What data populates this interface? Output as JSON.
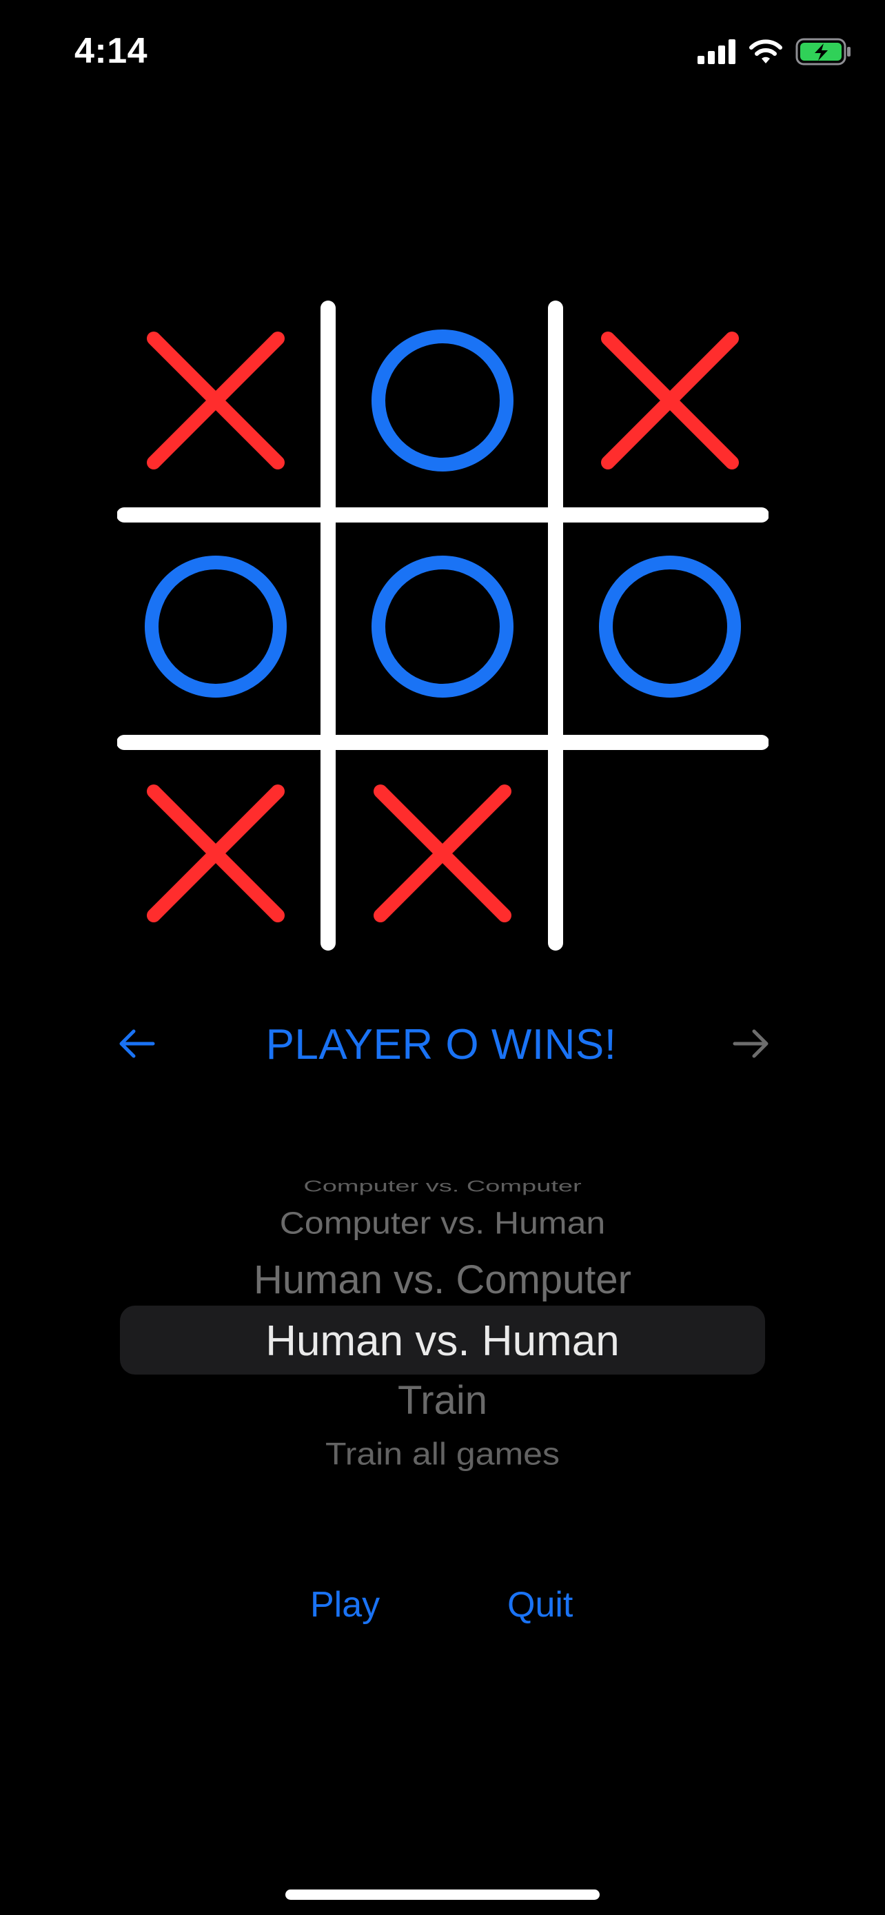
{
  "status_bar": {
    "time": "4:14",
    "icons": [
      "cellular-signal-icon",
      "wifi-icon",
      "battery-charging-icon"
    ]
  },
  "board": {
    "cells": [
      "X",
      "O",
      "X",
      "O",
      "O",
      "O",
      "X",
      "X",
      ""
    ],
    "x_color": "#ff2d2d",
    "o_color": "#1a73f5",
    "grid_color": "#ffffff"
  },
  "result": {
    "text": "PLAYER O WINS!",
    "left_arrow_icon": "arrow-left-icon",
    "right_arrow_icon": "arrow-right-icon"
  },
  "mode_picker": {
    "options": [
      "Computer vs. Computer",
      "Computer vs. Human",
      "Human vs. Computer",
      "Human vs. Human",
      "Train",
      "Train all games"
    ],
    "selected": "Human vs. Human"
  },
  "actions": {
    "play_label": "Play",
    "quit_label": "Quit"
  },
  "colors": {
    "background": "#000000",
    "accent": "#1a73f5",
    "x_mark": "#ff2d2d"
  }
}
